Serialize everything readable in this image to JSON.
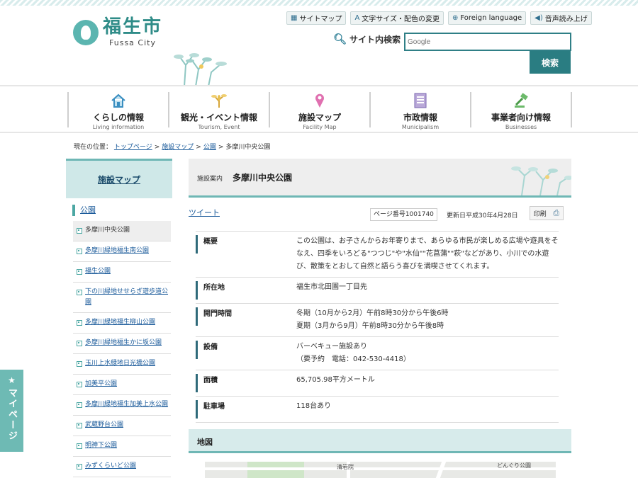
{
  "header": {
    "logo_jp": "福生市",
    "logo_en": "Fussa City",
    "utility_links": [
      {
        "label": "サイトマップ",
        "icon": "sitemap-icon"
      },
      {
        "label": "文字サイズ・配色の変更",
        "icon": "text-size-icon"
      },
      {
        "label": "Foreign language",
        "icon": "globe-icon"
      },
      {
        "label": "音声読み上げ",
        "icon": "speaker-icon"
      }
    ],
    "search_label": "サイト内検索",
    "search_placeholder": "Google",
    "search_button": "検索"
  },
  "nav": [
    {
      "label": "くらしの情報",
      "sub": "Living information",
      "icon": "house-icon"
    },
    {
      "label": "観光・イベント情報",
      "sub": "Tourism, Event",
      "icon": "plant-icon"
    },
    {
      "label": "施設マップ",
      "sub": "Facility Map",
      "icon": "map-pin-icon"
    },
    {
      "label": "市政情報",
      "sub": "Municipalism",
      "icon": "document-icon"
    },
    {
      "label": "事業者向け情報",
      "sub": "Businesses",
      "icon": "gavel-icon"
    }
  ],
  "breadcrumb": {
    "prefix": "現在の位置：",
    "links": [
      "トップページ",
      "施設マップ",
      "公園"
    ],
    "sep": ">",
    "current": "多摩川中央公園"
  },
  "sidebar": {
    "heading": "施設マップ",
    "category": "公園",
    "items": [
      {
        "label": "多摩川中央公園",
        "active": true
      },
      {
        "label": "多摩川緑地福生南公園"
      },
      {
        "label": "福生公園"
      },
      {
        "label": "下の川緑地せせらぎ遊歩道公園"
      },
      {
        "label": "多摩川緑地福生柳山公園"
      },
      {
        "label": "多摩川緑地福生かに坂公園"
      },
      {
        "label": "玉川上水緑地日光橋公園"
      },
      {
        "label": "加美平公園"
      },
      {
        "label": "多摩川緑地福生加美上水公園"
      },
      {
        "label": "武蔵野台公園"
      },
      {
        "label": "明神下公園"
      },
      {
        "label": "みずくらいど公園"
      }
    ]
  },
  "mypage": {
    "label": "マイページ"
  },
  "main": {
    "title_prefix": "施設案内",
    "title": "多摩川中央公園",
    "tweet": "ツイート",
    "page_number": "ページ番号1001740",
    "updated": "更新日平成30年4月28日",
    "print": "印刷",
    "info": [
      {
        "key": "概要",
        "value": "この公園は、お子さんからお年寄りまで、あらゆる市民が楽しめる広場や遊具をそなえ、四季をいろどる\"つつじ\"や\"水仙\"\"花菖蒲\"\"萩\"などがあり、小川での水遊び、散策をとおして自然と語らう喜びを満喫させてくれます。"
      },
      {
        "key": "所在地",
        "value": "福生市北田園一丁目先"
      },
      {
        "key": "開門時間",
        "value": "冬期（10月から2月）午前8時30分から午後6時\n夏期（3月から9月）午前8時30分から午後8時"
      },
      {
        "key": "設備",
        "value": "バーベキュー施設あり\n（要予約　電話：042-530-4418）"
      },
      {
        "key": "面積",
        "value": "65,705.98平方メートル"
      },
      {
        "key": "駐車場",
        "value": "118台あり"
      }
    ],
    "map_heading": "地図",
    "map_labels": [
      "清岩院",
      "どんぐり公園"
    ]
  },
  "colors": {
    "accent": "#2a7d82",
    "teal_light": "#cfe8e8",
    "link": "#1a5a9a"
  }
}
